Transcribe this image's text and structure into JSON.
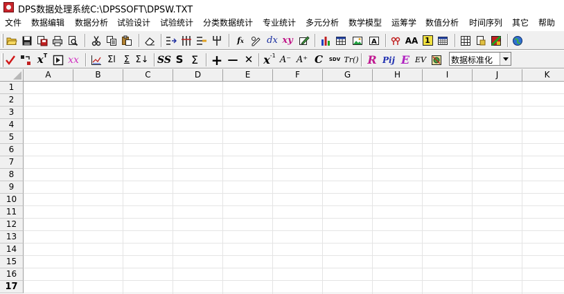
{
  "window": {
    "title": "DPS数据处理系统C:\\DPSSOFT\\DPSW.TXT"
  },
  "menu": [
    "文件",
    "数据编辑",
    "数据分析",
    "试验设计",
    "试验统计",
    "分类数据统计",
    "专业统计",
    "多元分析",
    "数学模型",
    "运筹学",
    "数值分析",
    "时间序列",
    "其它",
    "帮助"
  ],
  "toolbar1": {
    "icons": [
      "open-folder-icon",
      "save-disk-icon",
      "save-as-icon",
      "print-icon",
      "print-preview-icon",
      "cut-scissors-icon",
      "copy-icon",
      "paste-icon",
      "eraser-icon",
      "split-columns-icon",
      "insert-columns-icon",
      "merge-columns-icon",
      "tree-icon",
      "function-fx-icon",
      "formula-pen-icon",
      "derivative-icon",
      "xy-plot-icon",
      "edit-icon",
      "bar-chart-icon",
      "table-chart-icon",
      "image-icon",
      "text-box-icon",
      "link-icon",
      "font-size-icon",
      "number-one-icon",
      "calendar-grid-icon",
      "grid-table-icon",
      "page-icon",
      "color-picker-icon",
      "globe-icon"
    ],
    "labels": {
      "dx": "dx",
      "xy": "xy",
      "aa": "AA",
      "one": "1"
    }
  },
  "toolbar2": {
    "icons": [
      "checkmark-icon",
      "transpose-icon",
      "matrix-transpose-icon",
      "frame-icon",
      "sqrt-icon",
      "line-chart-icon",
      "sum-rows-icon",
      "sum-cols-icon",
      "sum-down-icon",
      "ss-icon",
      "s-icon",
      "sigma-icon",
      "plus-icon",
      "minus-icon",
      "multiply-icon",
      "power-icon",
      "decrease-icon",
      "increase-icon",
      "c-icon",
      "sdv-icon",
      "trace-icon",
      "r-icon",
      "pij-icon",
      "eigen-icon",
      "ev-icon",
      "settings-icon"
    ],
    "labels": {
      "ss": "SS",
      "s": "S",
      "sigma": "Σ",
      "sum_r": "Σl",
      "sum_c": "Σ",
      "sum_d": "Σ↓",
      "plus": "+",
      "minus": "—",
      "times": "✕",
      "xpow": "x",
      "a_minus": "A⁻",
      "a_plus": "A⁺",
      "c": "C",
      "sdv": "SDV",
      "trc": "Tr()",
      "r": "R",
      "pij": "Pij",
      "e": "E",
      "ev": "EV",
      "tex": "x",
      "xx": "xx"
    },
    "select_value": "数据标准化"
  },
  "sheet": {
    "columns": [
      "A",
      "B",
      "C",
      "D",
      "E",
      "F",
      "G",
      "H",
      "I",
      "J",
      "K"
    ],
    "rows": [
      "1",
      "2",
      "3",
      "4",
      "5",
      "6",
      "7",
      "8",
      "9",
      "10",
      "11",
      "12",
      "13",
      "14",
      "15",
      "16",
      "17"
    ],
    "active_row": "17"
  }
}
